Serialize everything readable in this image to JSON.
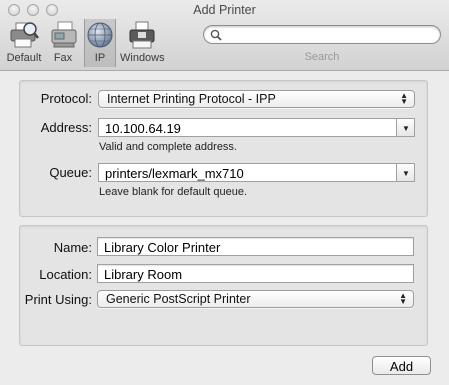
{
  "window": {
    "title": "Add Printer"
  },
  "toolbar": {
    "items": [
      {
        "label": "Default",
        "icon": "default-printer-icon",
        "selected": false
      },
      {
        "label": "Fax",
        "icon": "fax-icon",
        "selected": false
      },
      {
        "label": "IP",
        "icon": "globe-icon",
        "selected": true
      },
      {
        "label": "Windows",
        "icon": "windows-printer-icon",
        "selected": false
      }
    ],
    "search": {
      "placeholder": "",
      "value": "",
      "label": "Search"
    }
  },
  "connection": {
    "protocol_label": "Protocol:",
    "protocol_value": "Internet Printing Protocol - IPP",
    "address_label": "Address:",
    "address_value": "10.100.64.19",
    "address_hint": "Valid and complete address.",
    "queue_label": "Queue:",
    "queue_value": "printers/lexmark_mx710",
    "queue_hint": "Leave blank for default queue."
  },
  "details": {
    "name_label": "Name:",
    "name_value": "Library Color Printer",
    "location_label": "Location:",
    "location_value": "Library Room",
    "use_label": "Print Using:",
    "use_value": "Generic PostScript Printer"
  },
  "actions": {
    "add_label": "Add"
  }
}
